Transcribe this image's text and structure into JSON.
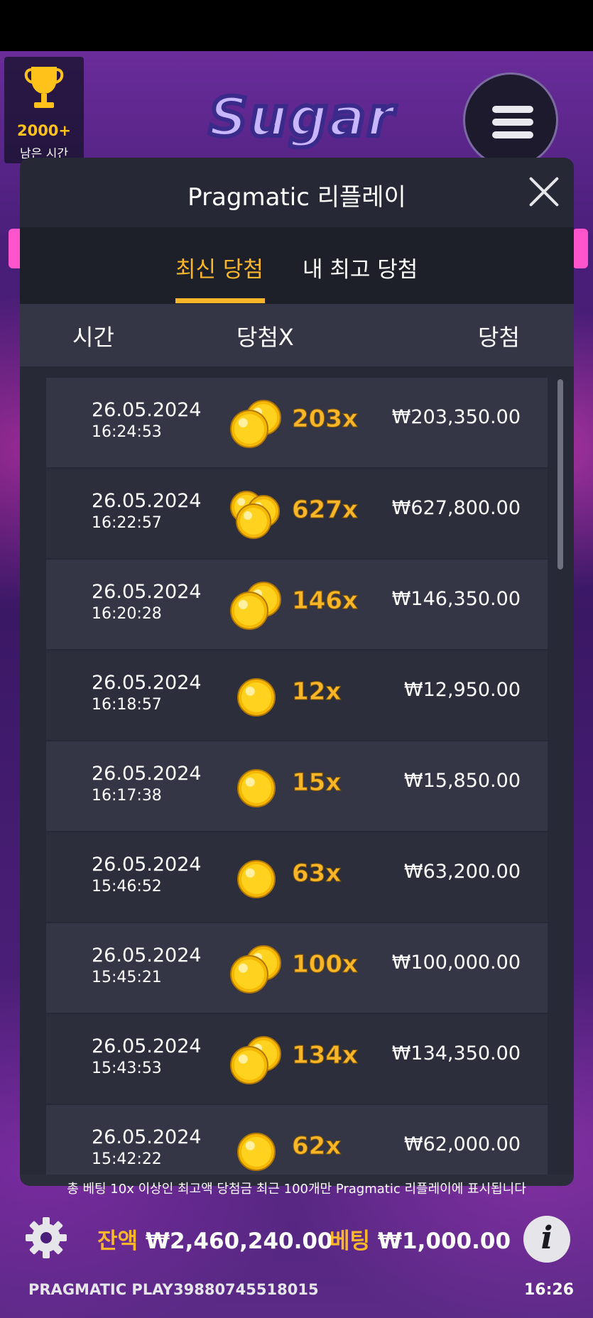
{
  "modal": {
    "title": "Pragmatic 리플레이",
    "tabs": {
      "active": "최신 당첨",
      "inactive": "내 최고 당첨"
    },
    "columns": {
      "time": "시간",
      "multiplier": "당첨X",
      "win": "당첨"
    },
    "rows": [
      {
        "date": "26.05.2024",
        "time": "16:24:53",
        "multiplier": "203x",
        "amount": "₩203,350.00",
        "coins": "2"
      },
      {
        "date": "26.05.2024",
        "time": "16:22:57",
        "multiplier": "627x",
        "amount": "₩627,800.00",
        "coins": "3"
      },
      {
        "date": "26.05.2024",
        "time": "16:20:28",
        "multiplier": "146x",
        "amount": "₩146,350.00",
        "coins": "2"
      },
      {
        "date": "26.05.2024",
        "time": "16:18:57",
        "multiplier": "12x",
        "amount": "₩12,950.00",
        "coins": "1"
      },
      {
        "date": "26.05.2024",
        "time": "16:17:38",
        "multiplier": "15x",
        "amount": "₩15,850.00",
        "coins": "1"
      },
      {
        "date": "26.05.2024",
        "time": "15:46:52",
        "multiplier": "63x",
        "amount": "₩63,200.00",
        "coins": "1"
      },
      {
        "date": "26.05.2024",
        "time": "15:45:21",
        "multiplier": "100x",
        "amount": "₩100,000.00",
        "coins": "2"
      },
      {
        "date": "26.05.2024",
        "time": "15:43:53",
        "multiplier": "134x",
        "amount": "₩134,350.00",
        "coins": "2"
      },
      {
        "date": "26.05.2024",
        "time": "15:42:22",
        "multiplier": "62x",
        "amount": "₩62,000.00",
        "coins": "1"
      }
    ],
    "footnote": "총 베팅 10x 이상인 최고액 당첨금 최근 100개만 Pragmatic 리플레이에 표시됩니다"
  },
  "trophy": {
    "count": "2000+",
    "label": "남은 시간"
  },
  "logo_text": "Sugar",
  "bottom_bar": {
    "balance_label": "잔액",
    "balance_value": "₩2,460,240.00",
    "bet_label": "베팅",
    "bet_value": "₩1,000.00",
    "info_glyph": "i"
  },
  "footer": {
    "brand": "PRAGMATIC PLAY",
    "session_id": "39880745518015",
    "clock": "16:26"
  },
  "icons": [
    "trophy-icon",
    "hamburger-menu-icon",
    "close-icon",
    "gold-coin-icon",
    "gear-icon",
    "info-icon"
  ],
  "colors": {
    "accent": "#f8b62b",
    "modal_bg": "#2b2d3b",
    "row_bg": "#343646"
  }
}
